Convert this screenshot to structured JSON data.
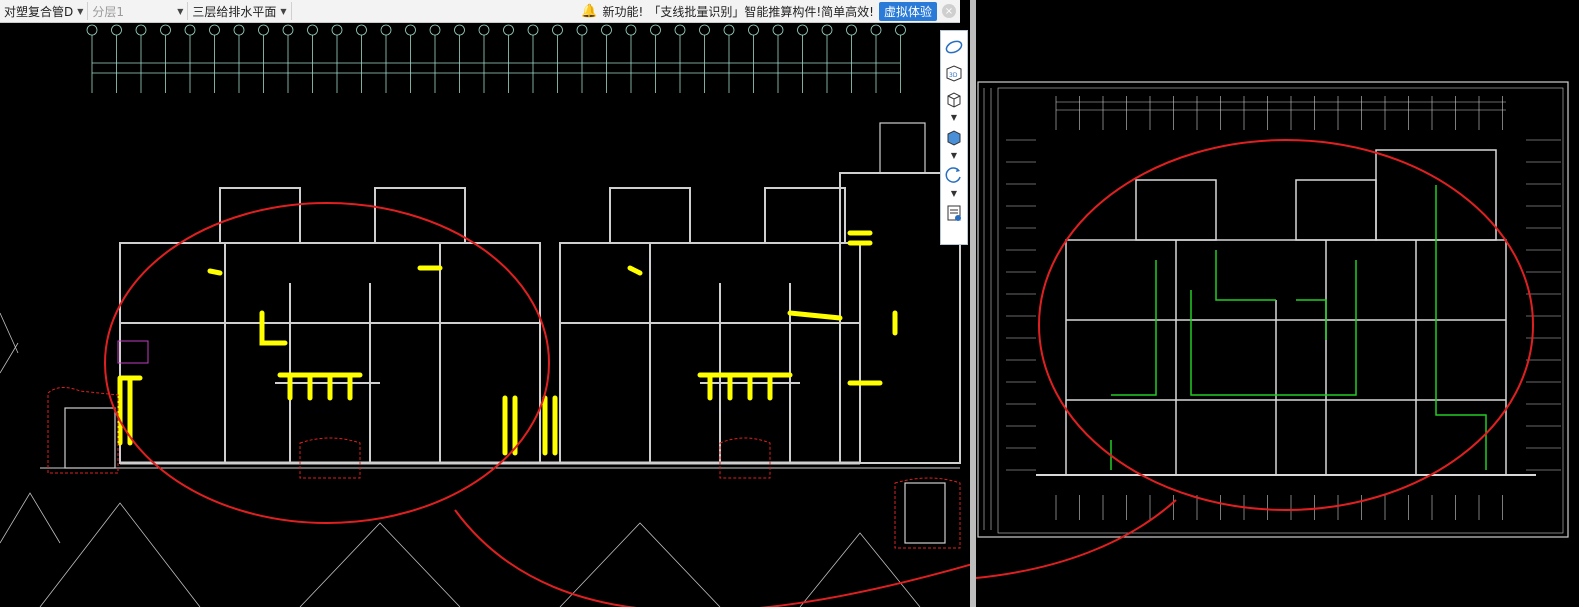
{
  "toolbar": {
    "component_select": "对塑复合管D",
    "layer_select": "分层1",
    "floor_select": "三层给排水平面",
    "notice_prefix": "新功能!",
    "notice_text": "「支线批量识别」智能推算构件!简单高效!",
    "try_button": "虚拟体验",
    "close_glyph": "×"
  },
  "icons": {
    "bell": "bell-icon",
    "view_tools": [
      "orbit-icon",
      "3d-view-icon",
      "box-view-icon",
      "solid-view-icon",
      "rotate-icon",
      "properties-panel-icon"
    ]
  },
  "colors": {
    "cad_background": "#000000",
    "walls": "#cfcfcf",
    "pipes_highlight": "#ffff00",
    "axis_lines": "#9fd8c8",
    "annotation_circle": "#e02020",
    "pipes_green": "#22cc22",
    "toolbar_accent": "#2a7ad8"
  }
}
